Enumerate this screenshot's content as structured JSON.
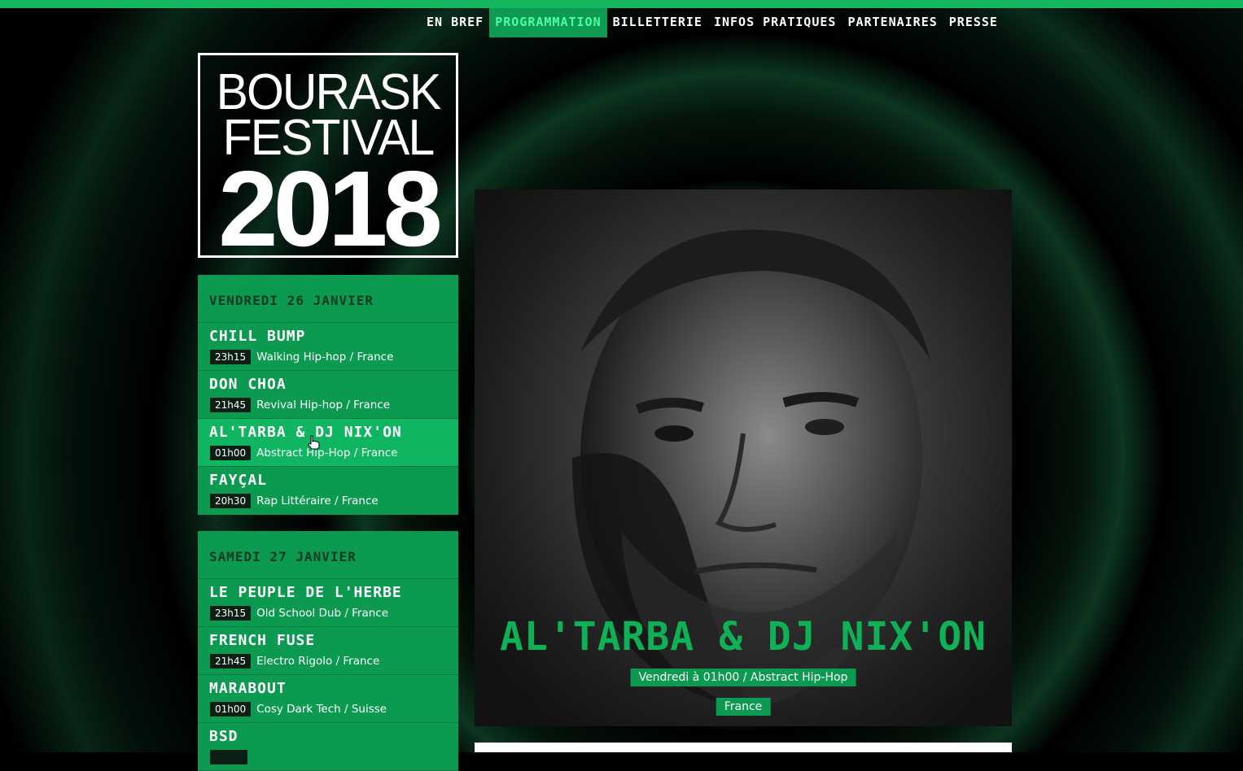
{
  "nav": [
    {
      "label": "En bref"
    },
    {
      "label": "Programmation",
      "active": true
    },
    {
      "label": "Billetterie"
    },
    {
      "label": "Infos pratiques"
    },
    {
      "label": "Partenaires"
    },
    {
      "label": "Presse"
    }
  ],
  "logo": {
    "line1": "BOURASK",
    "line2": "FESTIVAL",
    "line3": "2018"
  },
  "days": [
    {
      "label": "Vendredi 26 Janvier",
      "artists": [
        {
          "name": "Chill Bump",
          "time": "23h15",
          "genre": "Walking Hip-hop / France"
        },
        {
          "name": "Don Choa",
          "time": "21h45",
          "genre": "Revival Hip-hop / France"
        },
        {
          "name": "Al'Tarba & DJ Nix'On",
          "time": "01h00",
          "genre": "Abstract Hip-Hop / France"
        },
        {
          "name": "Fayçal",
          "time": "20h30",
          "genre": "Rap Littéraire / France"
        }
      ]
    },
    {
      "label": "Samedi 27 Janvier",
      "artists": [
        {
          "name": "Le Peuple de l'Herbe",
          "time": "23h15",
          "genre": "Old School Dub / France"
        },
        {
          "name": "French Fuse",
          "time": "21h45",
          "genre": "Electro Rigolo / France"
        },
        {
          "name": "Marabout",
          "time": "01h00",
          "genre": "Cosy Dark Tech / Suisse"
        },
        {
          "name": "BSD",
          "time": "",
          "genre": ""
        }
      ]
    }
  ],
  "feature": {
    "title": "Al'Tarba & DJ Nix'On",
    "info": "Vendredi à 01h00 / Abstract Hip-Hop",
    "country": "France"
  },
  "colors": {
    "accent": "#0b9a50",
    "accent_light": "#10b561",
    "title": "#0fb157"
  },
  "icons": {
    "cursor": "hand-pointer-icon"
  }
}
